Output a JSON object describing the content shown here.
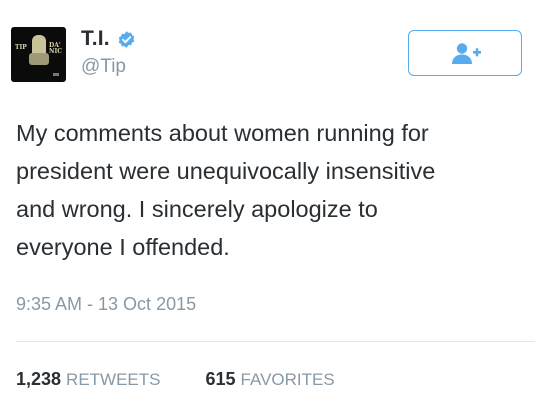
{
  "tweet": {
    "author": {
      "name": "T.I.",
      "handle": "@Tip",
      "verified": true,
      "avatar_text_left": "TIP",
      "avatar_text_right": "DA' NIC"
    },
    "follow_button": {
      "icon": "add-user-icon"
    },
    "text": "My comments about women running for\npresident were unequivocally insensitive\nand wrong.  I sincerely apologize to\neveryone I offended.",
    "timestamp": "9:35 AM - 13 Oct 2015",
    "stats": {
      "retweets_count": "1,238",
      "retweets_label": "RETWEETS",
      "favorites_count": "615",
      "favorites_label": "FAVORITES"
    }
  },
  "colors": {
    "accent": "#55acee",
    "text": "#292f33",
    "muted": "#8899a6",
    "divider": "#e1e8ed"
  }
}
